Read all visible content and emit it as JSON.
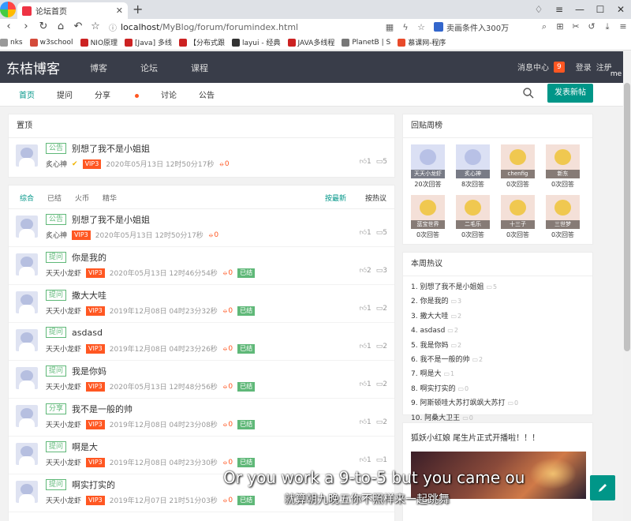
{
  "browser": {
    "tab_title": "论坛首页",
    "url_host": "localhost",
    "url_path": "/MyBlog/forum/forumindex.html",
    "search_text": "卖画条件入300万",
    "bookmarks": [
      {
        "label": "nks",
        "color": "#999999"
      },
      {
        "label": "w3school",
        "color": "#d44a3a"
      },
      {
        "label": "NIO原理",
        "color": "#cc2222"
      },
      {
        "label": "[Java] 多线",
        "color": "#cc2222"
      },
      {
        "label": "【分布式跟",
        "color": "#cc2222"
      },
      {
        "label": "layui - 经典",
        "color": "#333333"
      },
      {
        "label": "JAVA多线程",
        "color": "#cc2222"
      },
      {
        "label": "PlanetB | S",
        "color": "#777777"
      },
      {
        "label": "慕课网-程序",
        "color": "#e84a2a"
      }
    ]
  },
  "header": {
    "logo": "东桔博客",
    "nav": [
      "博客",
      "论坛",
      "课程"
    ],
    "message_label": "消息中心",
    "message_count": "9",
    "login": "登录",
    "register": "注册",
    "side_flag": "me"
  },
  "subnav": {
    "items": [
      "首页",
      "提问",
      "分享",
      "讨论",
      "公告"
    ],
    "post_button": "发表新帖"
  },
  "pinned": {
    "title": "置顶",
    "post": {
      "tag": "公告",
      "title": "别想了我不是小姐姐",
      "author": "炙心神",
      "vip": "VIP3",
      "time": "2020年05月13日 12时50分17秒",
      "coin": "0",
      "likes": "1",
      "comments": "5"
    }
  },
  "list": {
    "tabs": [
      "综合",
      "已结",
      "火币",
      "精华"
    ],
    "sort": [
      "按最新",
      "按热议"
    ],
    "posts": [
      {
        "tag": "公告",
        "title": "别想了我不是小姐姐",
        "author": "炙心神",
        "vip": "VIP3",
        "time": "2020年05月13日 12时50分17秒",
        "coin": "0",
        "done": "",
        "likes": "1",
        "comments": "5"
      },
      {
        "tag": "提问",
        "title": "你是我的",
        "author": "天天小龙虾",
        "vip": "VIP3",
        "time": "2020年05月13日 12时46分54秒",
        "coin": "0",
        "done": "已结",
        "likes": "2",
        "comments": "3"
      },
      {
        "tag": "提问",
        "title": "撒大大哇",
        "author": "天天小龙虾",
        "vip": "VIP3",
        "time": "2019年12月08日 04时23分32秒",
        "coin": "0",
        "done": "已结",
        "likes": "1",
        "comments": "2"
      },
      {
        "tag": "提问",
        "title": "asdasd",
        "author": "天天小龙虾",
        "vip": "VIP3",
        "time": "2019年12月08日 04时23分26秒",
        "coin": "0",
        "done": "已结",
        "likes": "1",
        "comments": "2"
      },
      {
        "tag": "提问",
        "title": "我是你妈",
        "author": "天天小龙虾",
        "vip": "VIP3",
        "time": "2020年05月13日 12时48分56秒",
        "coin": "0",
        "done": "已结",
        "likes": "1",
        "comments": "2"
      },
      {
        "tag": "分享",
        "title": "我不是一般的帅",
        "author": "天天小龙虾",
        "vip": "VIP3",
        "time": "2019年12月08日 04时23分08秒",
        "coin": "0",
        "done": "已结",
        "likes": "1",
        "comments": "2"
      },
      {
        "tag": "提问",
        "title": "啊是大",
        "author": "天天小龙虾",
        "vip": "VIP3",
        "time": "2019年12月08日 04时23分30秒",
        "coin": "0",
        "done": "已结",
        "likes": "1",
        "comments": "1"
      },
      {
        "tag": "提问",
        "title": "啊实打实的",
        "author": "天天小龙虾",
        "vip": "VIP3",
        "time": "2019年12月07日 21时51分03秒",
        "coin": "0",
        "done": "已结",
        "likes": "",
        "comments": ""
      }
    ]
  },
  "reply_ranking": {
    "title": "回贴周榜",
    "users": [
      {
        "name": "天天小龙虾",
        "count": "20次回答"
      },
      {
        "name": "炙心神",
        "count": "8次回答"
      },
      {
        "name": "chenfig",
        "count": "0次回答"
      },
      {
        "name": "新东",
        "count": "0次回答"
      },
      {
        "name": "蓝宝世界",
        "count": "0次回答"
      },
      {
        "name": "二毛乐",
        "count": "0次回答"
      },
      {
        "name": "十三子",
        "count": "0次回答"
      },
      {
        "name": "三世梦",
        "count": "0次回答"
      }
    ]
  },
  "hot_week": {
    "title": "本周热议",
    "items": [
      {
        "label": "1. 别想了我不是小姐姐",
        "count": "5"
      },
      {
        "label": "2. 你是我的",
        "count": "3"
      },
      {
        "label": "3. 撒大大哇",
        "count": "2"
      },
      {
        "label": "4. asdasd",
        "count": "2"
      },
      {
        "label": "5. 我是你妈",
        "count": "2"
      },
      {
        "label": "6. 我不是一般的帅",
        "count": "2"
      },
      {
        "label": "7. 啊是大",
        "count": "1"
      },
      {
        "label": "8. 啊实打实的",
        "count": "0"
      },
      {
        "label": "9. 阿斯顿哇大苏打飒飒大苏打",
        "count": "0"
      },
      {
        "label": "10. 阿桑大卫王",
        "count": "0"
      }
    ]
  },
  "ad": {
    "title": "狐妖小红娘 尾生片正式开播啦！！！"
  },
  "subtitles": {
    "english": "Or you work a 9-to-5 but you came ou",
    "chinese": "就算朝九晚五你不照样来一起跳舞"
  },
  "colors": {
    "accent": "#009688",
    "header_bg": "#393d49",
    "vip": "#ff5722",
    "done": "#5fb878"
  }
}
